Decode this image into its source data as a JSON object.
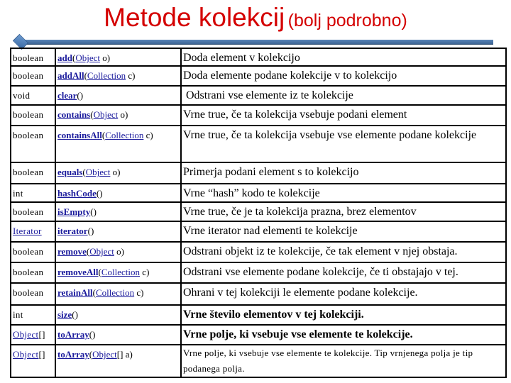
{
  "title": {
    "main": "Metode kolekcij",
    "sub": "(bolj podrobno)"
  },
  "colors": {
    "title": "#d40000",
    "rule": "#4a74a8",
    "link": "#1a1a9c"
  },
  "rows": [
    {
      "ret": "boolean",
      "ret_link": false,
      "method": "add",
      "params": [
        {
          "type": "Object",
          "type_link": true,
          "name": "o"
        }
      ],
      "desc": "Doda element v kolekcijo"
    },
    {
      "ret": "boolean",
      "ret_link": false,
      "method": "addAll",
      "params": [
        {
          "type": "Collection",
          "type_link": true,
          "name": "c"
        }
      ],
      "desc": "Doda elemente podane kolekcije v to kolekcijo"
    },
    {
      "ret": "void",
      "ret_link": false,
      "method": "clear",
      "params": [],
      "desc": " Odstrani vse elemente iz te kolekcije"
    },
    {
      "ret": "boolean",
      "ret_link": false,
      "method": "contains",
      "params": [
        {
          "type": "Object",
          "type_link": true,
          "name": "o"
        }
      ],
      "desc": "Vrne true, če ta kolekcija vsebuje podani element"
    },
    {
      "ret": "boolean",
      "ret_link": false,
      "method": "containsAll",
      "params": [
        {
          "type": "Collection",
          "type_link": true,
          "name": "c"
        }
      ],
      "desc": "Vrne true, če ta kolekcija vsebuje vse elemente podane kolekcije"
    },
    {
      "ret": "boolean",
      "ret_link": false,
      "method": "equals",
      "params": [
        {
          "type": "Object",
          "type_link": true,
          "name": "o"
        }
      ],
      "desc": "Primerja podani element s to kolekcijo"
    },
    {
      "ret": "int",
      "ret_link": false,
      "method": "hashCode",
      "params": [],
      "desc": "Vrne “hash” kodo te kolekcije"
    },
    {
      "ret": "boolean",
      "ret_link": false,
      "method": "isEmpty",
      "params": [],
      "desc": "Vrne true, če je ta kolekcija prazna, brez elementov"
    },
    {
      "ret": "Iterator",
      "ret_link": true,
      "method": "iterator",
      "params": [],
      "desc": "Vrne iterator nad elementi te kolekcije"
    },
    {
      "ret": "boolean",
      "ret_link": false,
      "method": "remove",
      "params": [
        {
          "type": "Object",
          "type_link": true,
          "name": "o"
        }
      ],
      "desc": "Odstrani objekt iz te kolekcije, če tak element v njej obstaja."
    },
    {
      "ret": "boolean",
      "ret_link": false,
      "method": "removeAll",
      "params": [
        {
          "type": "Collection",
          "type_link": true,
          "name": "c"
        }
      ],
      "desc": "Odstrani vse elemente podane kolekcije, če ti obstajajo v tej."
    },
    {
      "ret": "boolean",
      "ret_link": false,
      "method": "retainAll",
      "params": [
        {
          "type": "Collection",
          "type_link": true,
          "name": "c"
        }
      ],
      "desc": "Ohrani v tej kolekciji le elemente podane kolekcije."
    },
    {
      "ret": "int",
      "ret_link": false,
      "method": "size",
      "params": [],
      "desc": "Vrne število elementov v tej kolekciji."
    },
    {
      "ret": "Object[]",
      "ret_link": true,
      "method": "toArray",
      "params": [],
      "desc": "Vrne polje, ki vsebuje vse elemente te kolekcije."
    },
    {
      "ret": "Object[]",
      "ret_link": true,
      "method": "toArray",
      "params": [
        {
          "type": "Object",
          "type_link": true,
          "type_suffix": "[]",
          "name": "a"
        }
      ],
      "desc": "Vrne polje, ki vsebuje vse elemente te kolekcije. Tip vrnjenega polja je tip podanega polja."
    }
  ]
}
